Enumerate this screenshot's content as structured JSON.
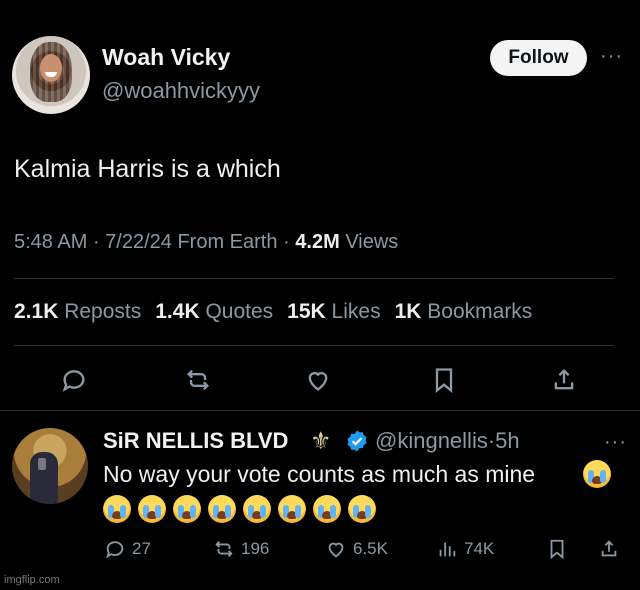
{
  "tweet": {
    "author_name": "Woah Vicky",
    "author_handle": "@woahhvickyyy",
    "follow_label": "Follow",
    "more_label": "···",
    "text": "Kalmia Harris is a which",
    "time": "5:48 AM",
    "date": "7/22/24",
    "source": "From Earth",
    "views_count": "4.2M",
    "views_label": "Views",
    "stats": {
      "reposts_count": "2.1K",
      "reposts_label": "Reposts",
      "quotes_count": "1.4K",
      "quotes_label": "Quotes",
      "likes_count": "15K",
      "likes_label": "Likes",
      "bookmarks_count": "1K",
      "bookmarks_label": "Bookmarks"
    },
    "actions": [
      "reply-icon",
      "repost-icon",
      "like-icon",
      "bookmark-icon",
      "share-icon"
    ]
  },
  "reply": {
    "author_name": "SiR NELLIS BLVD",
    "badge_glyph": "⚜",
    "verified_icon": "verified-badge-icon",
    "author_handle": "@kingnellis",
    "age": "5h",
    "more_label": "···",
    "text": "No way your vote counts as much as mine",
    "emoji_icon": "loudly-crying-face-icon",
    "emoji_row_count": 8,
    "actions": {
      "replies": "27",
      "reposts": "196",
      "likes": "6.5K",
      "views": "74K"
    }
  },
  "watermark": "imgflip.com",
  "colors": {
    "background": "#000000",
    "primary_text": "#e7e9ea",
    "secondary_text": "#8b98a5",
    "divider": "#2f3336",
    "follow_bg": "#f4f4f4",
    "verified": "#1d9bf0"
  }
}
